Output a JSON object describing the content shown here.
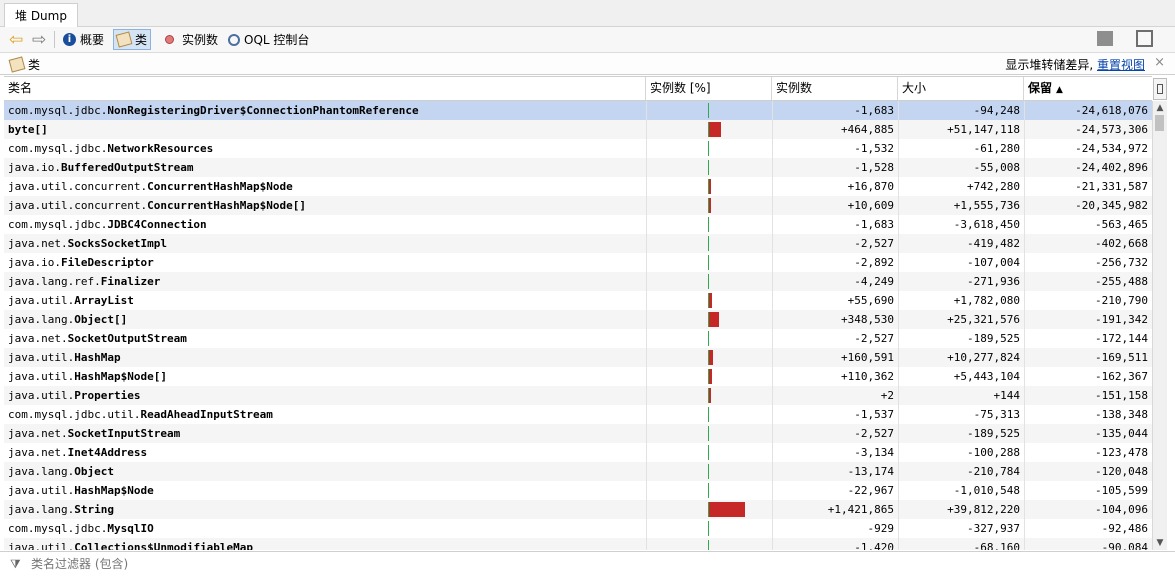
{
  "window": {
    "title_tab": "堆 Dump"
  },
  "toolbar": {
    "back_icon": "arrow-left-icon",
    "forward_icon": "arrow-right-icon",
    "summary_label": "概要",
    "classes_label": "类",
    "instances_label": "实例数",
    "oql_label": "OQL 控制台"
  },
  "panel": {
    "title": "类",
    "compare_text": "显示堆转储差异,",
    "reset_view_label": "重置视图",
    "close_symbol": "×"
  },
  "table": {
    "columns": {
      "name": "类名",
      "percent": "实例数 [%]",
      "count": "实例数",
      "size": "大小",
      "retained": "保留"
    },
    "rows": [
      {
        "pkg": "com.mysql.jdbc.",
        "cls": "NonRegisteringDriver$ConnectionPhantomReference",
        "pct": 0,
        "count": "-1,683",
        "size": "-94,248",
        "retained": "-24,618,076"
      },
      {
        "pkg": "",
        "cls": "byte[]",
        "pct": 9.8,
        "count": "+464,885",
        "size": "+51,147,118",
        "retained": "-24,573,306"
      },
      {
        "pkg": "com.mysql.jdbc.",
        "cls": "NetworkResources",
        "pct": 0,
        "count": "-1,532",
        "size": "-61,280",
        "retained": "-24,534,972"
      },
      {
        "pkg": "java.io.",
        "cls": "BufferedOutputStream",
        "pct": 0,
        "count": "-1,528",
        "size": "-55,008",
        "retained": "-24,402,896"
      },
      {
        "pkg": "java.util.concurrent.",
        "cls": "ConcurrentHashMap$Node",
        "pct": 0.8,
        "count": "+16,870",
        "size": "+742,280",
        "retained": "-21,331,587"
      },
      {
        "pkg": "java.util.concurrent.",
        "cls": "ConcurrentHashMap$Node[]",
        "pct": 0.5,
        "count": "+10,609",
        "size": "+1,555,736",
        "retained": "-20,345,982"
      },
      {
        "pkg": "com.mysql.jdbc.",
        "cls": "JDBC4Connection",
        "pct": 0,
        "count": "-1,683",
        "size": "-3,618,450",
        "retained": "-563,465"
      },
      {
        "pkg": "java.net.",
        "cls": "SocksSocketImpl",
        "pct": 0,
        "count": "-2,527",
        "size": "-419,482",
        "retained": "-402,668"
      },
      {
        "pkg": "java.io.",
        "cls": "FileDescriptor",
        "pct": 0,
        "count": "-2,892",
        "size": "-107,004",
        "retained": "-256,732"
      },
      {
        "pkg": "java.lang.ref.",
        "cls": "Finalizer",
        "pct": 0,
        "count": "-4,249",
        "size": "-271,936",
        "retained": "-255,488"
      },
      {
        "pkg": "java.util.",
        "cls": "ArrayList",
        "pct": 2.4,
        "count": "+55,690",
        "size": "+1,782,080",
        "retained": "-210,790"
      },
      {
        "pkg": "java.lang.",
        "cls": "Object[]",
        "pct": 7.6,
        "count": "+348,530",
        "size": "+25,321,576",
        "retained": "-191,342"
      },
      {
        "pkg": "java.net.",
        "cls": "SocketOutputStream",
        "pct": 0,
        "count": "-2,527",
        "size": "-189,525",
        "retained": "-172,144"
      },
      {
        "pkg": "java.util.",
        "cls": "HashMap",
        "pct": 3.4,
        "count": "+160,591",
        "size": "+10,277,824",
        "retained": "-169,511"
      },
      {
        "pkg": "java.util.",
        "cls": "HashMap$Node[]",
        "pct": 2.4,
        "count": "+110,362",
        "size": "+5,443,104",
        "retained": "-162,367"
      },
      {
        "pkg": "java.util.",
        "cls": "Properties",
        "pct": 0.2,
        "count": "+2",
        "size": "+144",
        "retained": "-151,158"
      },
      {
        "pkg": "com.mysql.jdbc.util.",
        "cls": "ReadAheadInputStream",
        "pct": 0,
        "count": "-1,537",
        "size": "-75,313",
        "retained": "-138,348"
      },
      {
        "pkg": "java.net.",
        "cls": "SocketInputStream",
        "pct": 0,
        "count": "-2,527",
        "size": "-189,525",
        "retained": "-135,044"
      },
      {
        "pkg": "java.net.",
        "cls": "Inet4Address",
        "pct": 0,
        "count": "-3,134",
        "size": "-100,288",
        "retained": "-123,478"
      },
      {
        "pkg": "java.lang.",
        "cls": "Object",
        "pct": 0,
        "count": "-13,174",
        "size": "-210,784",
        "retained": "-120,048"
      },
      {
        "pkg": "java.util.",
        "cls": "HashMap$Node",
        "pct": 0,
        "count": "-22,967",
        "size": "-1,010,548",
        "retained": "-105,599"
      },
      {
        "pkg": "java.lang.",
        "cls": "String",
        "pct": 28.5,
        "count": "+1,421,865",
        "size": "+39,812,220",
        "retained": "-104,096"
      },
      {
        "pkg": "com.mysql.jdbc.",
        "cls": "MysqlIO",
        "pct": 0,
        "count": "-929",
        "size": "-327,937",
        "retained": "-92,486"
      },
      {
        "pkg": "java.util.",
        "cls": "Collections$UnmodifiableMap",
        "pct": 0,
        "count": "-1,420",
        "size": "-68,160",
        "retained": "-90,084"
      }
    ]
  },
  "filter": {
    "placeholder": "类名过滤器 (包含)"
  },
  "colors": {
    "bar": "#c62828",
    "baseline": "#2fa84f",
    "selected_row": "#c3d5f0",
    "link": "#0645ad"
  }
}
